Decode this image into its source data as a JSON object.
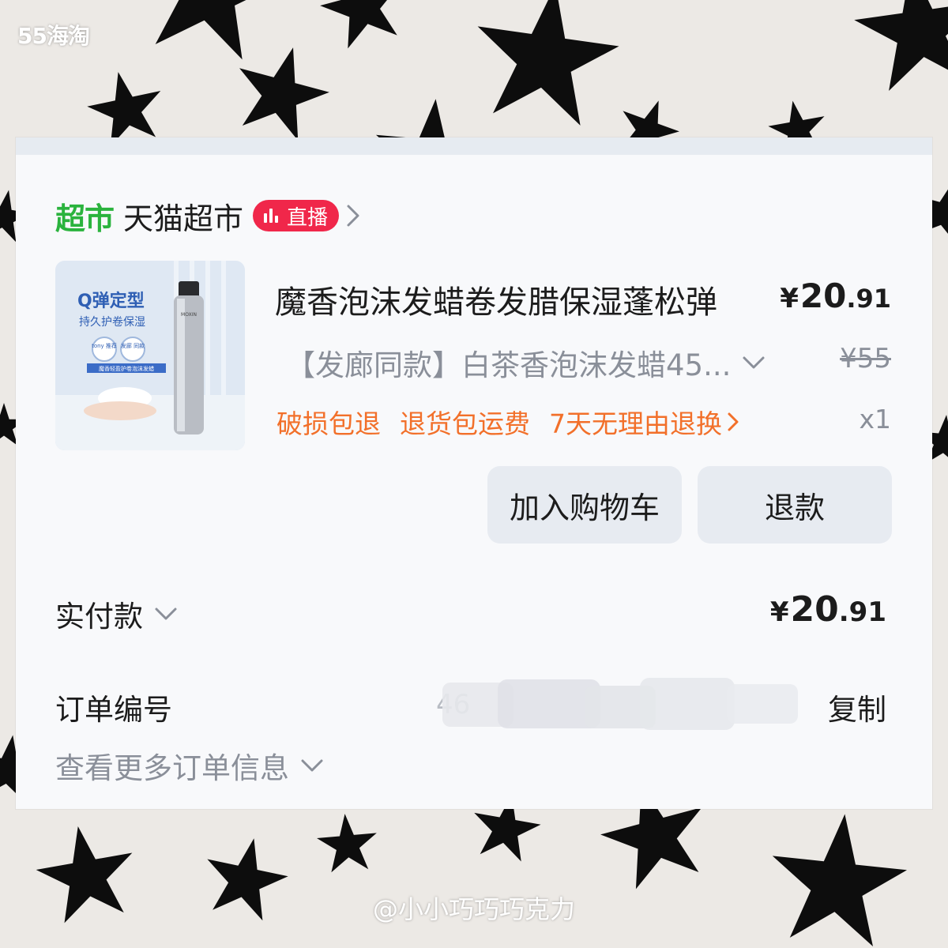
{
  "watermark_top": "55海淘",
  "watermark_bottom": "@小小巧巧巧克力",
  "store": {
    "logo_text": "超市",
    "name": "天猫超市",
    "live_badge": "直播"
  },
  "product": {
    "title": "魔香泡沫发蜡卷发腊保湿蓬松弹",
    "price_symbol": "¥",
    "price_int": "20",
    "price_dec": ".91",
    "sku": "【发廊同款】白茶香泡沫发蜡45...",
    "original_price": "¥55",
    "services": [
      "破损包退",
      "退货包运费",
      "7天无理由退换"
    ],
    "quantity": "x1",
    "image_text": {
      "line1": "Q弹定型",
      "line2": "持久护卷保湿",
      "tag1": "tony 推荐",
      "tag2": "发廊 同款",
      "banner": "魔香轻盈护卷泡沫发蜡",
      "can_brand": "MOXIN"
    }
  },
  "actions": {
    "add_to_cart": "加入购物车",
    "refund": "退款"
  },
  "payment": {
    "label": "实付款",
    "symbol": "¥",
    "amount_int": "20",
    "amount_dec": ".91"
  },
  "order": {
    "label": "订单编号",
    "number_visible": "46",
    "copy_label": "复制",
    "more_info": "查看更多订单信息"
  },
  "colors": {
    "brand_green": "#2ab33d",
    "live_red": "#f0274a",
    "service_orange": "#f2702a",
    "muted_gray": "#8a8f99"
  }
}
